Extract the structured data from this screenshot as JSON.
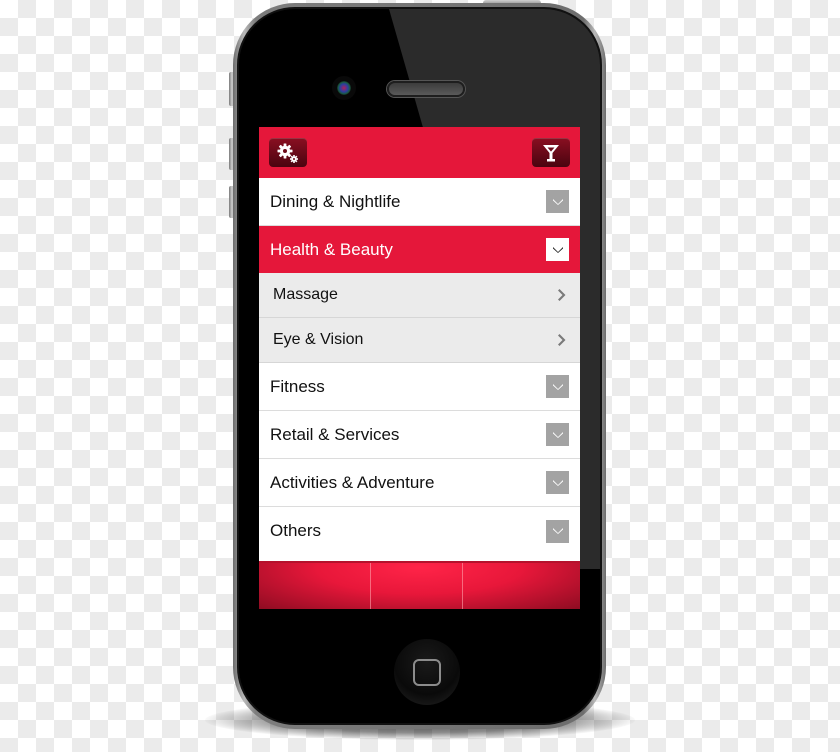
{
  "device": {
    "type": "smartphone",
    "colors": {
      "accent": "#e5173a",
      "header_button": "#6b0a19",
      "dropdown_inactive": "#a3a3a3",
      "submenu_bg": "#ebebeb"
    }
  },
  "header": {
    "left_button": {
      "icon": "gears-icon",
      "label": "Settings"
    },
    "right_button": {
      "icon": "cocktail-filter-icon",
      "label": "Filter"
    }
  },
  "menu": {
    "categories": [
      {
        "label": "Dining & Nightlife",
        "expanded": false,
        "icon": "chevron-down-icon"
      },
      {
        "label": "Health & Beauty",
        "expanded": true,
        "icon": "chevron-down-icon",
        "subitems": [
          {
            "label": "Massage",
            "icon": "chevron-right-icon"
          },
          {
            "label": "Eye & Vision",
            "icon": "chevron-right-icon"
          }
        ]
      },
      {
        "label": "Fitness",
        "expanded": false,
        "icon": "chevron-down-icon"
      },
      {
        "label": "Retail & Services",
        "expanded": false,
        "icon": "chevron-down-icon"
      },
      {
        "label": "Activities & Adventure",
        "expanded": false,
        "icon": "chevron-down-icon"
      },
      {
        "label": "Others",
        "expanded": false,
        "icon": "chevron-down-icon"
      }
    ]
  },
  "footer": {
    "tabs": [
      {
        "label": ""
      },
      {
        "label": ""
      },
      {
        "label": ""
      }
    ]
  }
}
